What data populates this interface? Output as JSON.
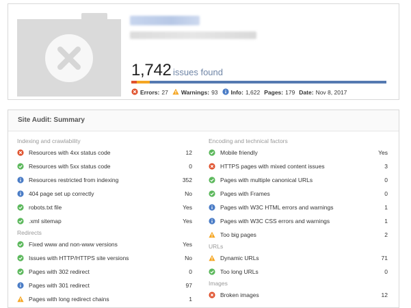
{
  "header": {
    "issues_count": "1,742",
    "issues_label": "issues found",
    "stats": [
      {
        "key": "errors",
        "label": "Errors:",
        "value": "27",
        "icon": "error-icon"
      },
      {
        "key": "warnings",
        "label": "Warnings:",
        "value": "93",
        "icon": "warning-icon"
      },
      {
        "key": "info",
        "label": "Info:",
        "value": "1,622",
        "icon": "info-icon"
      },
      {
        "key": "pages",
        "label": "Pages:",
        "value": "179"
      },
      {
        "key": "date",
        "label": "Date:",
        "value": "Nov 8, 2017"
      }
    ]
  },
  "summary": {
    "title": "Site Audit: Summary",
    "left": {
      "sections": [
        {
          "title": "Indexing and crawlability",
          "rows": [
            {
              "status": "error",
              "label": "Resources with 4xx status code",
              "value": "12"
            },
            {
              "status": "ok",
              "label": "Resources with 5xx status code",
              "value": "0"
            },
            {
              "status": "info",
              "label": "Resources restricted from indexing",
              "value": "352"
            },
            {
              "status": "info",
              "label": "404 page set up correctly",
              "value": "No"
            },
            {
              "status": "ok",
              "label": "robots.txt file",
              "value": "Yes"
            },
            {
              "status": "ok",
              "label": ".xml sitemap",
              "value": "Yes"
            }
          ]
        },
        {
          "title": "Redirects",
          "rows": [
            {
              "status": "ok",
              "label": "Fixed www and non-www versions",
              "value": "Yes"
            },
            {
              "status": "ok",
              "label": "Issues with HTTP/HTTPS site versions",
              "value": "No"
            },
            {
              "status": "ok",
              "label": "Pages with 302 redirect",
              "value": "0"
            },
            {
              "status": "info",
              "label": "Pages with 301 redirect",
              "value": "97"
            },
            {
              "status": "warning",
              "label": "Pages with long redirect chains",
              "value": "1"
            }
          ]
        }
      ]
    },
    "right": {
      "sections": [
        {
          "title": "Encoding and technical factors",
          "rows": [
            {
              "status": "ok",
              "label": "Mobile friendly",
              "value": "Yes"
            },
            {
              "status": "error",
              "label": "HTTPS pages with mixed content issues",
              "value": "3"
            },
            {
              "status": "ok",
              "label": "Pages with multiple canonical URLs",
              "value": "0"
            },
            {
              "status": "ok",
              "label": "Pages with Frames",
              "value": "0"
            },
            {
              "status": "info",
              "label": "Pages with W3C HTML errors and warnings",
              "value": "1"
            },
            {
              "status": "info",
              "label": "Pages with W3C CSS errors and warnings",
              "value": "1"
            },
            {
              "status": "warning",
              "label": "Too big pages",
              "value": "2"
            }
          ]
        },
        {
          "title": "URLs",
          "rows": [
            {
              "status": "warning",
              "label": "Dynamic URLs",
              "value": "71"
            },
            {
              "status": "ok",
              "label": "Too long URLs",
              "value": "0"
            }
          ]
        },
        {
          "title": "Images",
          "rows": [
            {
              "status": "error",
              "label": "Broken images",
              "value": "12"
            }
          ]
        }
      ]
    }
  },
  "colors": {
    "error": "#e0532f",
    "ok": "#5cb85c",
    "info": "#4a7cc6",
    "warning": "#f5a623",
    "bar": "#557ab1"
  }
}
